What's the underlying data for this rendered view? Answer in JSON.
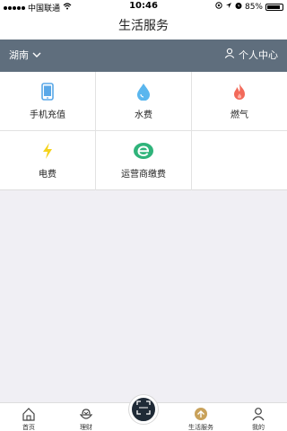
{
  "status_bar": {
    "carrier": "中国联通",
    "time": "10:46",
    "battery": "85%",
    "battery_level": 0.85,
    "icons": [
      "signal-dots-icon",
      "wifi-icon",
      "location-icon",
      "alarm-icon",
      "battery-icon"
    ]
  },
  "header": {
    "title": "生活服务"
  },
  "region_bar": {
    "region": "湖南",
    "user_center": "个人中心",
    "background": "#5f6e7d"
  },
  "services": [
    {
      "label": "手机充值",
      "icon": "mobile-phone-icon",
      "color": "#5aa8e8"
    },
    {
      "label": "水费",
      "icon": "water-drop-icon",
      "color": "#5ab6ee"
    },
    {
      "label": "燃气",
      "icon": "flame-icon",
      "color": "#f26a5a"
    },
    {
      "label": "电费",
      "icon": "lightning-icon",
      "color": "#f5d31c"
    },
    {
      "label": "运营商缴费",
      "icon": "carrier-e-icon",
      "color": "#2fb37a"
    }
  ],
  "tabbar": {
    "tabs": [
      {
        "label": "首页",
        "icon": "home-icon"
      },
      {
        "label": "理财",
        "icon": "finance-icon"
      },
      {
        "label": "",
        "icon": "scan-icon"
      },
      {
        "label": "生活服务",
        "icon": "life-service-icon",
        "active": true
      },
      {
        "label": "我的",
        "icon": "person-icon"
      }
    ],
    "active_color": "#c9a25b"
  }
}
